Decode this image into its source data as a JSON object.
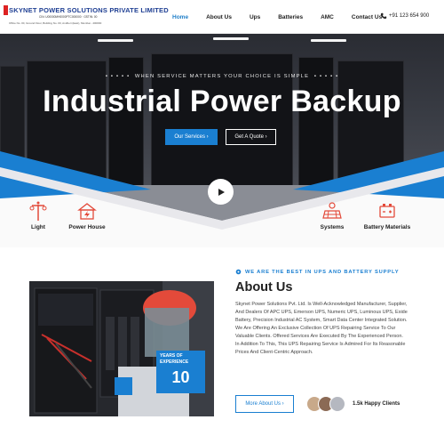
{
  "header": {
    "logo_title": "SKYNET POWER SOLUTIONS PRIVATE LIMITED",
    "logo_subtitle": "CIN: U00000MH0000PTC000000 · GSTIN: 00",
    "logo_address": "Office No. 00, Ground Floor, Building No. 00, Andheri (East), Mumbai - 400000",
    "nav": [
      {
        "label": "Home",
        "active": true
      },
      {
        "label": "About Us",
        "active": false
      },
      {
        "label": "Ups",
        "active": false
      },
      {
        "label": "Batteries",
        "active": false
      },
      {
        "label": "AMC",
        "active": false
      },
      {
        "label": "Contact Us",
        "active": false
      }
    ],
    "phone": "+91 123 654 900"
  },
  "hero": {
    "tagline": "WHEN SERVICE MATTERS YOUR CHOICE IS SIMPLE",
    "title": "Industrial Power Backup",
    "btn_services": "Our Services  ›",
    "btn_quote": "Get A Quote  ›"
  },
  "services": [
    {
      "label": "Light",
      "icon": "street-light-icon"
    },
    {
      "label": "Power House",
      "icon": "power-house-icon"
    },
    {
      "label": "Systems",
      "icon": "solar-system-icon"
    },
    {
      "label": "Battery Materials",
      "icon": "battery-materials-icon"
    }
  ],
  "about": {
    "kicker": "WE ARE THE BEST IN UPS AND BATTERY SUPPLY",
    "title": "About Us",
    "paragraphs": [
      "Skynet Power Solutions Pvt. Ltd. Is Well-Acknowledged Manufacturer, Supplier, And Dealers Of APC UPS, Emerson UPS, Numeric UPS, Luminous UPS, Exide Battery, Precision Industrial AC System, Smart Data Center Integrated Solution.",
      "We Are Offering An Exclusive Collection Of UPS Repairing Service To Our Valuable Clients. Offered Services Are Executed By The Experienced Person.",
      "In Addition To This, This UPS Repairing Service Is Admired For Its Reasonable Prices And Client-Centric Approach."
    ],
    "experience_label": "YEARS OF EXPERIENCE",
    "experience_years": "10",
    "btn_more": "More About Us  ›",
    "happy_clients": "1.5k Happy Clients"
  },
  "colors": {
    "accent": "#1a7fd1",
    "brand_red": "#e34a3a",
    "logo_blue": "#1f3f93"
  }
}
